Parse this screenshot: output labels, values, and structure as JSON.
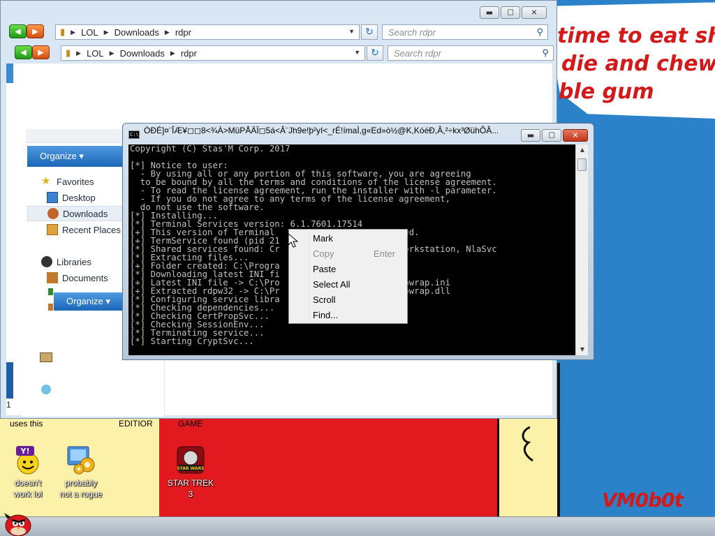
{
  "wallpaper": {
    "bubble_lines": [
      "time to eat shit",
      "die and chew",
      "ble gum"
    ],
    "signature": "VM0b0t",
    "captions": {
      "uses_this": "uses this",
      "editor": "EDITIOR",
      "game": "GAME"
    },
    "colors": {
      "blue": "#2b82c8",
      "red": "#e21a1f",
      "yellow": "#fbf1a8",
      "text_red": "#d4191b"
    }
  },
  "desktop_icons": [
    {
      "label_lines": [
        "doesn't",
        "work lol"
      ],
      "icon": "yahoo-messenger-icon"
    },
    {
      "label_lines": [
        "probably",
        "not a rogue"
      ],
      "icon": "gears-program-icon"
    },
    {
      "label_lines": [
        "STAR TREK",
        "3"
      ],
      "icon": "star-wars-game-icon",
      "badge": "STAR WARS"
    }
  ],
  "explorer_back": {
    "breadcrumb": [
      "LOL",
      "Downloads",
      "rdpr"
    ],
    "search_placeholder": "Search rdpr"
  },
  "explorer_front": {
    "breadcrumb": [
      "LOL",
      "Downloads",
      "rdpr"
    ],
    "search_placeholder": "Search rdpr",
    "organize_label": "Organize ▾",
    "organize_label_2": "Organize ▾",
    "nav": {
      "favorites": "Favorites",
      "desktop": "Desktop",
      "downloads": "Downloads",
      "recent": "Recent Places",
      "libraries": "Libraries",
      "documents": "Documents"
    },
    "status_count": "1"
  },
  "console": {
    "title": "ÒÐÉ]¤¨ÎÆ¥◻◻8<¾À>MüPÅÄÏ◻5á<Â¨Jh9e!þ²yI<_rÉ!ímaÌ,g«Ed»ò½@K,KóéÐ,Â,²÷kx³ØühÔÂ...",
    "lines": [
      "Copyright (C) Stas'M Corp. 2017",
      "",
      "[*] Notice to user:",
      "  - By using all or any portion of this software, you are agreeing",
      "  to be bound by all the terms and conditions of the license agreement.",
      "  - To read the license agreement, run the installer with -l parameter.",
      "  - If you do not agree to any terms of the license agreement,",
      "  do not use the software.",
      "[*] Installing...",
      "[*] Terminal Services version: 6.1.7601.17514",
      "[+] This version of Terminal                     ported.",
      "[+] TermService found (pid 21",
      "[*] Shared services found: Cr                    manWorkstation, NlaSvc",
      "[*] Extracting files...",
      "[+] Folder created: C:\\Progra",
      "[*] Downloading latest INI fi",
      "[+] Latest INI file -> C:\\Pro                    r\\rdpwrap.ini",
      "[+] Extracted rdpw32 -> C:\\Pr                    r\\rdpwrap.dll",
      "[*] Configuring service libra",
      "[*] Checking dependencies...",
      "[*] Checking CertPropSvc...",
      "[*] Checking SessionEnv...",
      "[*] Terminating service...",
      "[*] Starting CryptSvc..."
    ]
  },
  "context_menu": {
    "items": [
      {
        "label": "Mark",
        "enabled": true
      },
      {
        "label": "Copy",
        "enabled": false,
        "accelerator": "Enter"
      },
      {
        "label": "Paste",
        "enabled": true
      },
      {
        "label": "Select All",
        "enabled": true
      },
      {
        "label": "Scroll",
        "enabled": true
      },
      {
        "label": "Find...",
        "enabled": true
      }
    ]
  },
  "window_buttons": {
    "minimize": "▬",
    "maximize": "☐",
    "close": "✕"
  },
  "taskbar": {
    "start_icon": "angry-bird-icon"
  }
}
